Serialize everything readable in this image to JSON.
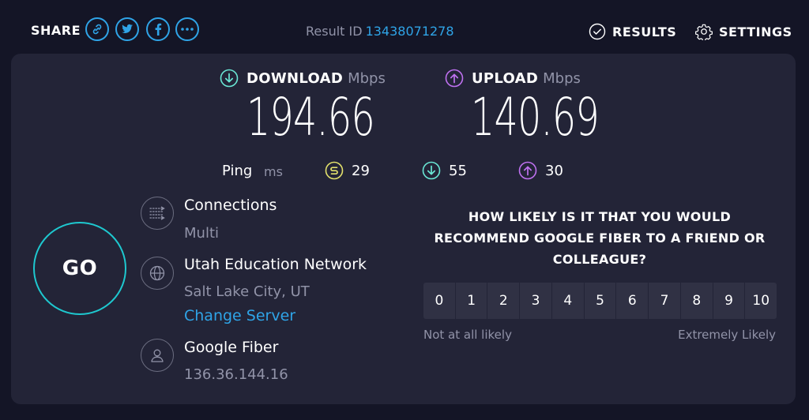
{
  "colors": {
    "background": "#141526",
    "panel": "#232437",
    "accent_blue": "#2fa4e7",
    "go_ring": "#1ec8cf",
    "download": "#6ae7d5",
    "upload": "#bf71f0",
    "idle_ping": "#e3e16c",
    "muted_text": "#9193a8"
  },
  "header": {
    "share_label": "SHARE",
    "share_buttons": [
      "link-icon",
      "twitter-icon",
      "facebook-icon",
      "more-icon"
    ],
    "result_id_label": "Result ID",
    "result_id": "13438071278",
    "results_label": "RESULTS",
    "settings_label": "SETTINGS"
  },
  "download": {
    "label": "DOWNLOAD",
    "unit": "Mbps",
    "value": "194.66",
    "icon": "download-arrow-icon"
  },
  "upload": {
    "label": "UPLOAD",
    "unit": "Mbps",
    "value": "140.69",
    "icon": "upload-arrow-icon"
  },
  "ping": {
    "label": "Ping",
    "unit": "ms",
    "idle": "29",
    "download": "55",
    "upload": "30"
  },
  "go_label": "GO",
  "connections": {
    "title": "Connections",
    "value": "Multi"
  },
  "server": {
    "name": "Utah Education Network",
    "location": "Salt Lake City, UT",
    "change_label": "Change Server"
  },
  "isp": {
    "name": "Google Fiber",
    "ip": "136.36.144.16"
  },
  "survey": {
    "question": "HOW LIKELY IS IT THAT YOU WOULD RECOMMEND GOOGLE FIBER TO A FRIEND OR COLLEAGUE?",
    "scale": [
      "0",
      "1",
      "2",
      "3",
      "4",
      "5",
      "6",
      "7",
      "8",
      "9",
      "10"
    ],
    "low_label": "Not at all likely",
    "high_label": "Extremely Likely"
  }
}
